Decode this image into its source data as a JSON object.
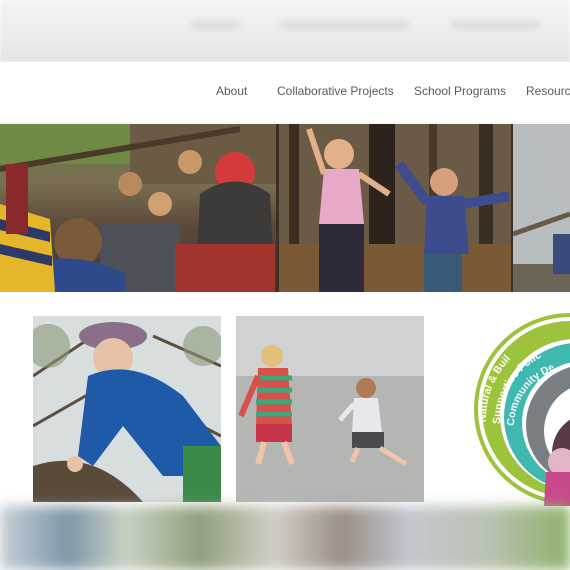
{
  "nav": {
    "items": [
      {
        "label": "About"
      },
      {
        "label": "Collaborative Projects"
      },
      {
        "label": "School Programs"
      },
      {
        "label": "Resource"
      }
    ]
  },
  "circle_logo": {
    "rings": [
      {
        "label": "Natural & Buil",
        "color": "#9cc33b"
      },
      {
        "label": "Supportive Polic",
        "color": "#3fb8b0"
      },
      {
        "label": "Community De",
        "color": "#7a7f84"
      }
    ]
  },
  "colors": {
    "nav_text": "#555b60",
    "accent_green": "#9cc33b",
    "accent_teal": "#3fb8b0"
  }
}
